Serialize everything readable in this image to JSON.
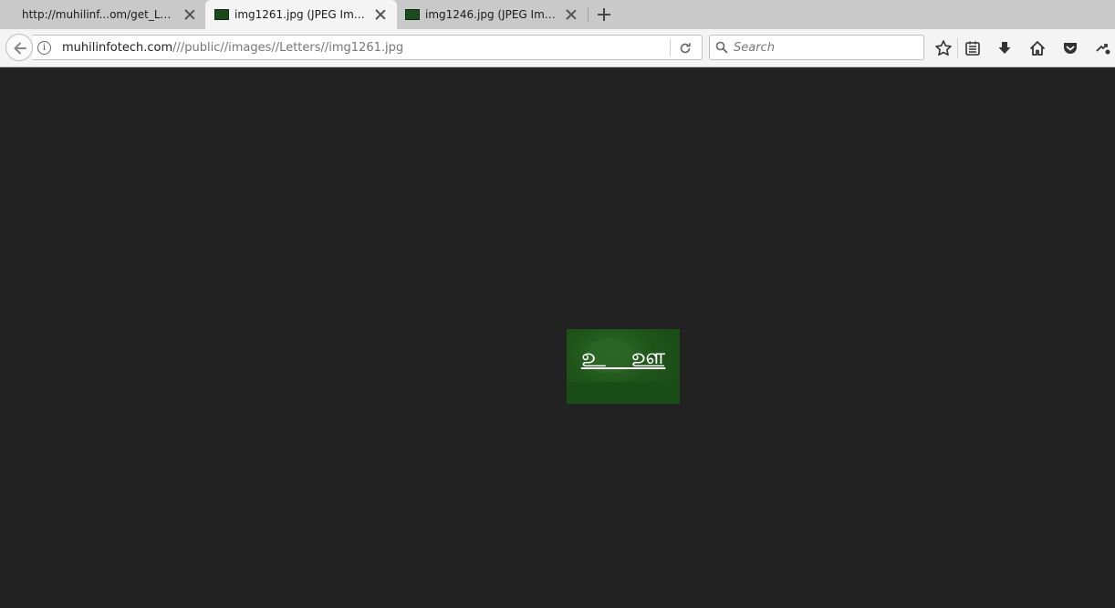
{
  "tabs": [
    {
      "title": "http://muhilinf...om/get_Letters",
      "active": false,
      "has_favicon": false
    },
    {
      "title": "img1261.jpg (JPEG Image, ...",
      "active": true,
      "has_favicon": true
    },
    {
      "title": "img1246.jpg (JPEG Image, ...",
      "active": false,
      "has_favicon": true
    }
  ],
  "urlbar": {
    "domain": "muhilinfotech.com",
    "path": "///public//images//Letters//img1261.jpg"
  },
  "search": {
    "placeholder": "Search"
  },
  "toolbar_icons": [
    "star-icon",
    "reading-list-icon",
    "download-icon",
    "home-icon",
    "pocket-icon",
    "extension-icon"
  ],
  "image": {
    "text": "உ ஊ",
    "background_color": "#1f5419"
  },
  "colors": {
    "viewer_background": "#222222",
    "tabstrip": "#c9c9c9",
    "navbar": "#f4f4f4"
  }
}
